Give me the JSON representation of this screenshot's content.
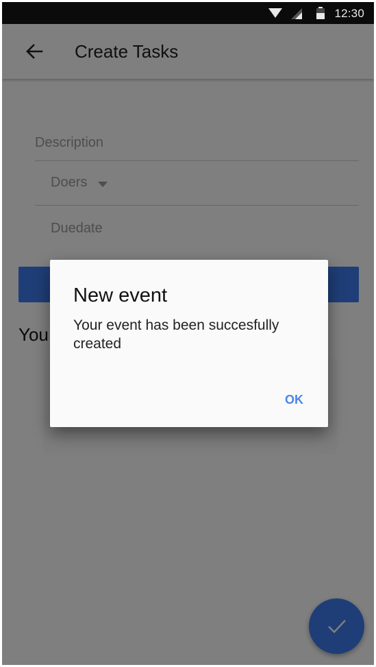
{
  "status_bar": {
    "time": "12:30"
  },
  "app_bar": {
    "title": "Create Tasks"
  },
  "form": {
    "description_label": "Description",
    "doers_label": "Doers",
    "duedate_label": "Duedate",
    "status_text": "You"
  },
  "dialog": {
    "title": "New event",
    "message": "Your event has been succesfully created",
    "ok_label": "OK"
  },
  "colors": {
    "accent": "#3f7df0",
    "dialog_button": "#4b86e8"
  }
}
